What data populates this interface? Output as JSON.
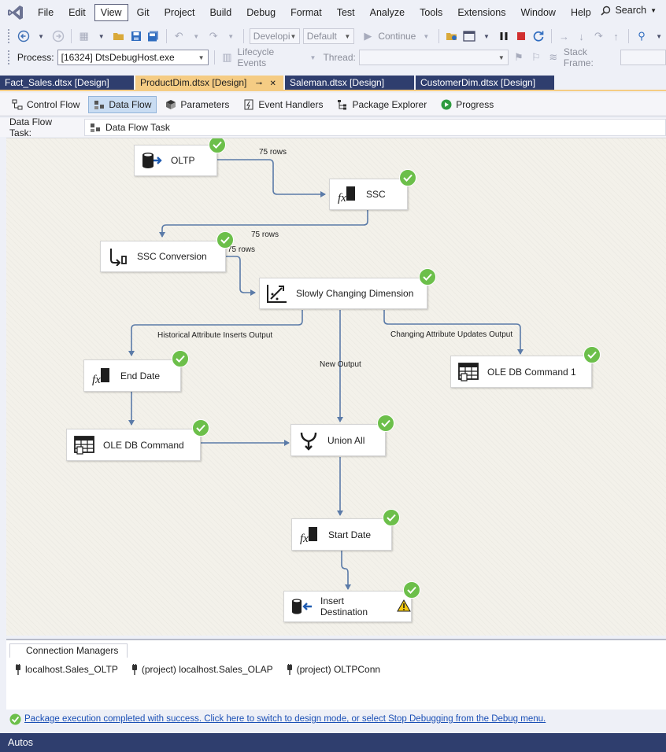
{
  "menu": {
    "items": [
      "File",
      "Edit",
      "View",
      "Git",
      "Project",
      "Build",
      "Debug",
      "Format",
      "Test",
      "Analyze",
      "Tools",
      "Extensions",
      "Window",
      "Help"
    ],
    "active": "View",
    "search_label": "Search"
  },
  "toolbar": {
    "config_value": "Developi",
    "platform_value": "Default",
    "continue_label": "Continue",
    "process_label": "Process:",
    "process_value": "[16324] DtsDebugHost.exe",
    "lifecycle_label": "Lifecycle Events",
    "thread_label": "Thread:",
    "thread_value": "",
    "stackframe_label": "Stack Frame:",
    "stackframe_value": ""
  },
  "doc_tabs": [
    {
      "label": "Fact_Sales.dtsx [Design]",
      "active": false
    },
    {
      "label": "ProductDim.dtsx [Design]",
      "active": true
    },
    {
      "label": "Saleman.dtsx [Design]",
      "active": false
    },
    {
      "label": "CustomerDim.dtsx [Design]",
      "active": false
    }
  ],
  "designer_tabs": [
    {
      "label": "Control Flow",
      "icon": "control-flow-icon",
      "active": false
    },
    {
      "label": "Data Flow",
      "icon": "data-flow-icon",
      "active": true
    },
    {
      "label": "Parameters",
      "icon": "parameters-icon",
      "active": false
    },
    {
      "label": "Event Handlers",
      "icon": "event-handlers-icon",
      "active": false
    },
    {
      "label": "Package Explorer",
      "icon": "package-explorer-icon",
      "active": false
    },
    {
      "label": "Progress",
      "icon": "progress-icon",
      "active": false
    }
  ],
  "task": {
    "label": "Data Flow Task:",
    "value": "Data Flow Task"
  },
  "nodes": {
    "oltp": {
      "label": "OLTP",
      "icon": "source-icon",
      "status": "success"
    },
    "ssc": {
      "label": "SSC",
      "icon": "derived-column-icon",
      "status": "success"
    },
    "ssc_conversion": {
      "label": "SSC Conversion",
      "icon": "data-conversion-icon",
      "status": "success"
    },
    "scd": {
      "label": "Slowly Changing Dimension",
      "icon": "scd-icon",
      "status": "success"
    },
    "end_date": {
      "label": "End Date",
      "icon": "derived-column-icon",
      "status": "success"
    },
    "ole_db_command": {
      "label": "OLE DB Command",
      "icon": "ole-db-command-icon",
      "status": "success"
    },
    "ole_db_command_1": {
      "label": "OLE DB Command 1",
      "icon": "ole-db-command-icon",
      "status": "success"
    },
    "union_all": {
      "label": "Union All",
      "icon": "union-all-icon",
      "status": "success"
    },
    "start_date": {
      "label": "Start Date",
      "icon": "derived-column-icon",
      "status": "success"
    },
    "insert_destination": {
      "label": "Insert Destination",
      "icon": "destination-icon",
      "status": "success",
      "warning": true
    }
  },
  "flow_labels": {
    "oltp_to_ssc": "75 rows",
    "ssc_to_conversion": "75 rows",
    "conversion_to_scd": "75 rows",
    "historical": "Historical Attribute Inserts Output",
    "new_output": "New Output",
    "changing": "Changing Attribute Updates Output"
  },
  "connection_managers": {
    "tab_label": "Connection Managers",
    "items": [
      "localhost.Sales_OLTP",
      "(project) localhost.Sales_OLAP",
      "(project) OLTPConn"
    ]
  },
  "status": {
    "message": "Package execution completed with success. Click here to switch to design mode, or select Stop Debugging from the Debug menu."
  },
  "autos": {
    "title": "Autos"
  },
  "colors": {
    "accent_tab": "#f5cc84",
    "inactive_tab": "#2f3e6e",
    "success": "#6cbf4a",
    "connector": "#5b7ba8"
  }
}
